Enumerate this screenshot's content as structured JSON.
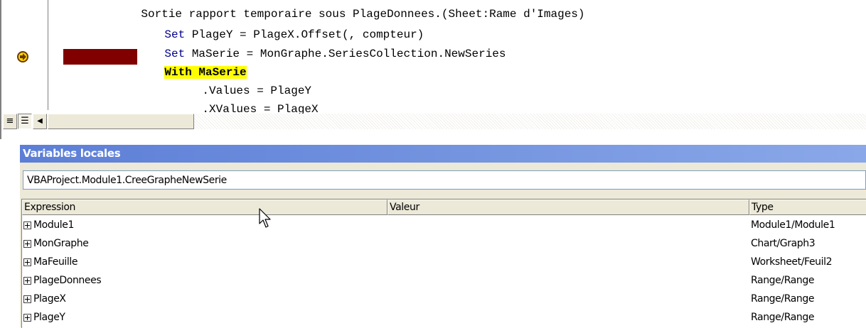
{
  "code": {
    "partial_top_line": "Sortie rapport temporaire sous PlageDonnees.(Sheet:Rame d'Images)",
    "lines": [
      {
        "keyword": "Set",
        "rest": " PlageY = PlageX.Offset(, compteur)"
      },
      {
        "keyword": "Set",
        "rest": " MaSerie = MonGraphe.SeriesCollection.NewSeries"
      },
      {
        "keyword": "",
        "highlighted": "With MaSerie"
      },
      {
        "keyword": "",
        "rest": ".Values = PlageY"
      },
      {
        "keyword": "",
        "rest": ".XValues = PlageX"
      }
    ],
    "colors": {
      "keyword": "#00008b",
      "highlight": "#ffff00",
      "breakpoint": "#800000",
      "exec_arrow": "#ffd700"
    },
    "view_buttons": {
      "procedure_view": "≡",
      "full_module_view": "☰"
    },
    "scroll_left": "◀"
  },
  "locals": {
    "title": "Variables locales",
    "context": "VBAProject.Module1.CreeGrapheNewSerie",
    "columns": {
      "expression": "Expression",
      "value": "Valeur",
      "type": "Type"
    },
    "rows": [
      {
        "expression": "Module1",
        "value": "",
        "type": "Module1/Module1"
      },
      {
        "expression": "MonGraphe",
        "value": "",
        "type": "Chart/Graph3"
      },
      {
        "expression": "MaFeuille",
        "value": "",
        "type": "Worksheet/Feuil2"
      },
      {
        "expression": "PlageDonnees",
        "value": "",
        "type": "Range/Range"
      },
      {
        "expression": "PlageX",
        "value": "",
        "type": "Range/Range"
      },
      {
        "expression": "PlageY",
        "value": "",
        "type": "Range/Range"
      }
    ],
    "colors": {
      "titlebar": "#6b8ddf",
      "title_text": "#ffffff"
    }
  }
}
